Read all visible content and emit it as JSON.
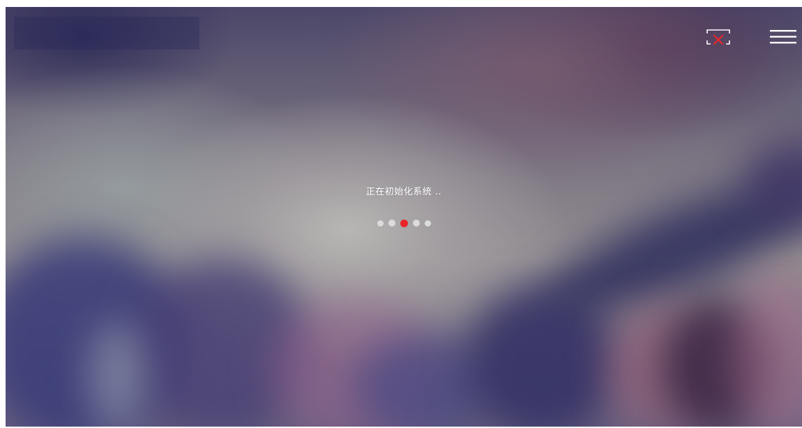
{
  "loading": {
    "message": "正在初始化系统",
    "ellipsis": " ..",
    "dots": [
      {
        "state": "inactive"
      },
      {
        "state": "inactive"
      },
      {
        "state": "active"
      },
      {
        "state": "inactive"
      },
      {
        "state": "inactive"
      }
    ]
  },
  "toolbar": {
    "screen_off_icon": "screen-off-icon",
    "menu_icon": "hamburger-menu-icon"
  },
  "colors": {
    "active_dot": "#e8262a",
    "inactive_dot": "#dcdcdc",
    "icon_white": "#ffffff",
    "icon_red": "#e8262a",
    "text": "#ffffff"
  }
}
